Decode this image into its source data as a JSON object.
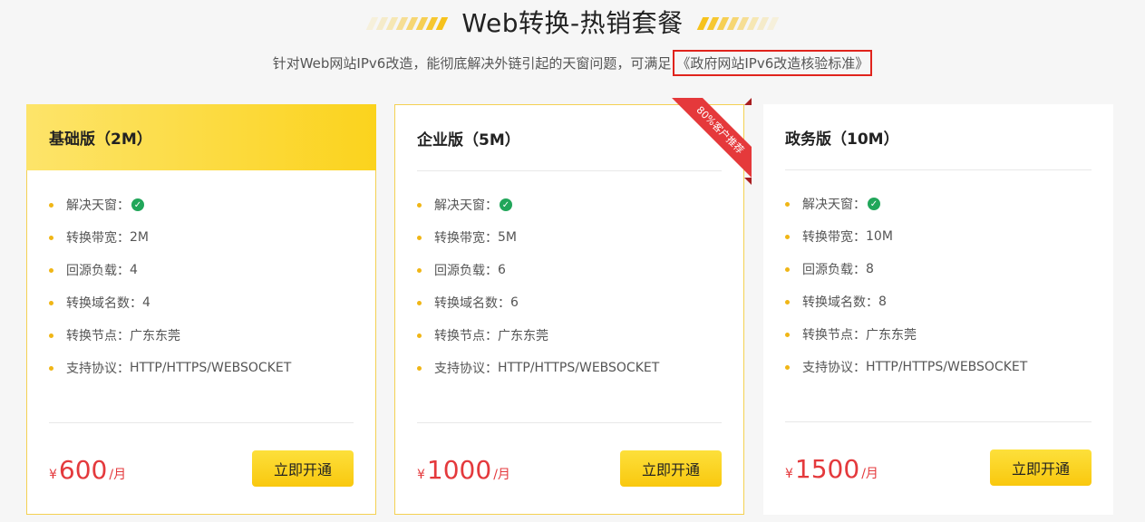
{
  "header": {
    "title": "Web转换-热销套餐",
    "subtitle": "针对Web网站IPv6改造，能彻底解决外链引起的天窗问题，可满足",
    "standard_link": "《政府网站IPv6改造核验标准》"
  },
  "colors": {
    "accent": "#f9c80e",
    "price": "#e4393c",
    "ribbon": "#e5393b",
    "check": "#21a65a"
  },
  "plans": [
    {
      "name": "基础版（2M）",
      "features": [
        {
          "label": "解决天窗：",
          "value": "",
          "icon": "check-icon"
        },
        {
          "label": "转换带宽：",
          "value": "2M"
        },
        {
          "label": "回源负载：",
          "value": "4"
        },
        {
          "label": "转换域名数：",
          "value": "4"
        },
        {
          "label": "转换节点：",
          "value": "广东东莞"
        },
        {
          "label": "支持协议：",
          "value": "HTTP/HTTPS/WEBSOCKET"
        }
      ],
      "currency": "¥",
      "price": "600",
      "unit": "/月",
      "button": "立即开通"
    },
    {
      "name": "企业版（5M）",
      "ribbon": "80%客户推荐",
      "features": [
        {
          "label": "解决天窗：",
          "value": "",
          "icon": "check-icon"
        },
        {
          "label": "转换带宽：",
          "value": "5M"
        },
        {
          "label": "回源负载：",
          "value": "6"
        },
        {
          "label": "转换域名数：",
          "value": "6"
        },
        {
          "label": "转换节点：",
          "value": "广东东莞"
        },
        {
          "label": "支持协议：",
          "value": "HTTP/HTTPS/WEBSOCKET"
        }
      ],
      "currency": "¥",
      "price": "1000",
      "unit": "/月",
      "button": "立即开通"
    },
    {
      "name": "政务版（10M）",
      "features": [
        {
          "label": "解决天窗：",
          "value": "",
          "icon": "check-icon"
        },
        {
          "label": "转换带宽：",
          "value": "10M"
        },
        {
          "label": "回源负载：",
          "value": "8"
        },
        {
          "label": "转换域名数：",
          "value": "8"
        },
        {
          "label": "转换节点：",
          "value": "广东东莞"
        },
        {
          "label": "支持协议：",
          "value": "HTTP/HTTPS/WEBSOCKET"
        }
      ],
      "currency": "¥",
      "price": "1500",
      "unit": "/月",
      "button": "立即开通"
    }
  ]
}
